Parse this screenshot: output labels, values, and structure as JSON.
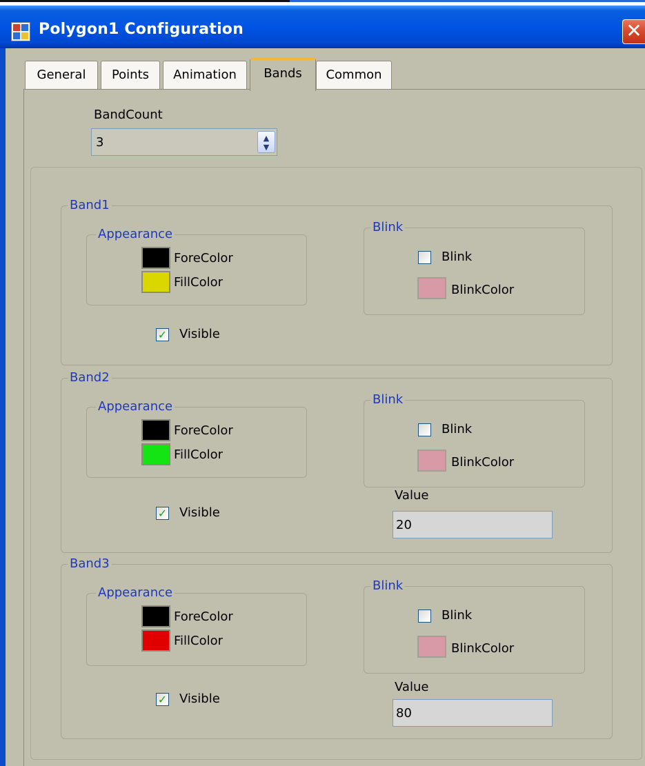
{
  "window": {
    "title": "Polygon1 Configuration",
    "close_label": "✕"
  },
  "tabs": [
    {
      "label": "General",
      "active": false
    },
    {
      "label": "Points",
      "active": false
    },
    {
      "label": "Animation",
      "active": false
    },
    {
      "label": "Bands",
      "active": true
    },
    {
      "label": "Common",
      "active": false
    }
  ],
  "band_count": {
    "label": "BandCount",
    "value": "3"
  },
  "bands": [
    {
      "title": "Band1",
      "appearance_title": "Appearance",
      "fore_color_label": "ForeColor",
      "fore_color": "#000000",
      "fill_color_label": "FillColor",
      "fill_color": "#d9d600",
      "blink_group_title": "Blink",
      "blink_label": "Blink",
      "blink_checked": false,
      "blink_color_label": "BlinkColor",
      "blink_color": "#d89aa6",
      "visible_label": "Visible",
      "visible_checked": true
    },
    {
      "title": "Band2",
      "appearance_title": "Appearance",
      "fore_color_label": "ForeColor",
      "fore_color": "#000000",
      "fill_color_label": "FillColor",
      "fill_color": "#14e414",
      "blink_group_title": "Blink",
      "blink_label": "Blink",
      "blink_checked": false,
      "blink_color_label": "BlinkColor",
      "blink_color": "#d89aa6",
      "visible_label": "Visible",
      "visible_checked": true,
      "value_label": "Value",
      "value": "20"
    },
    {
      "title": "Band3",
      "appearance_title": "Appearance",
      "fore_color_label": "ForeColor",
      "fore_color": "#000000",
      "fill_color_label": "FillColor",
      "fill_color": "#e00000",
      "blink_group_title": "Blink",
      "blink_label": "Blink",
      "blink_checked": false,
      "blink_color_label": "BlinkColor",
      "blink_color": "#d89aa6",
      "visible_label": "Visible",
      "visible_checked": true,
      "value_label": "Value",
      "value": "80"
    }
  ],
  "checkmark": "✓",
  "spin_arrows": {
    "up": "▲",
    "down": "▼"
  }
}
